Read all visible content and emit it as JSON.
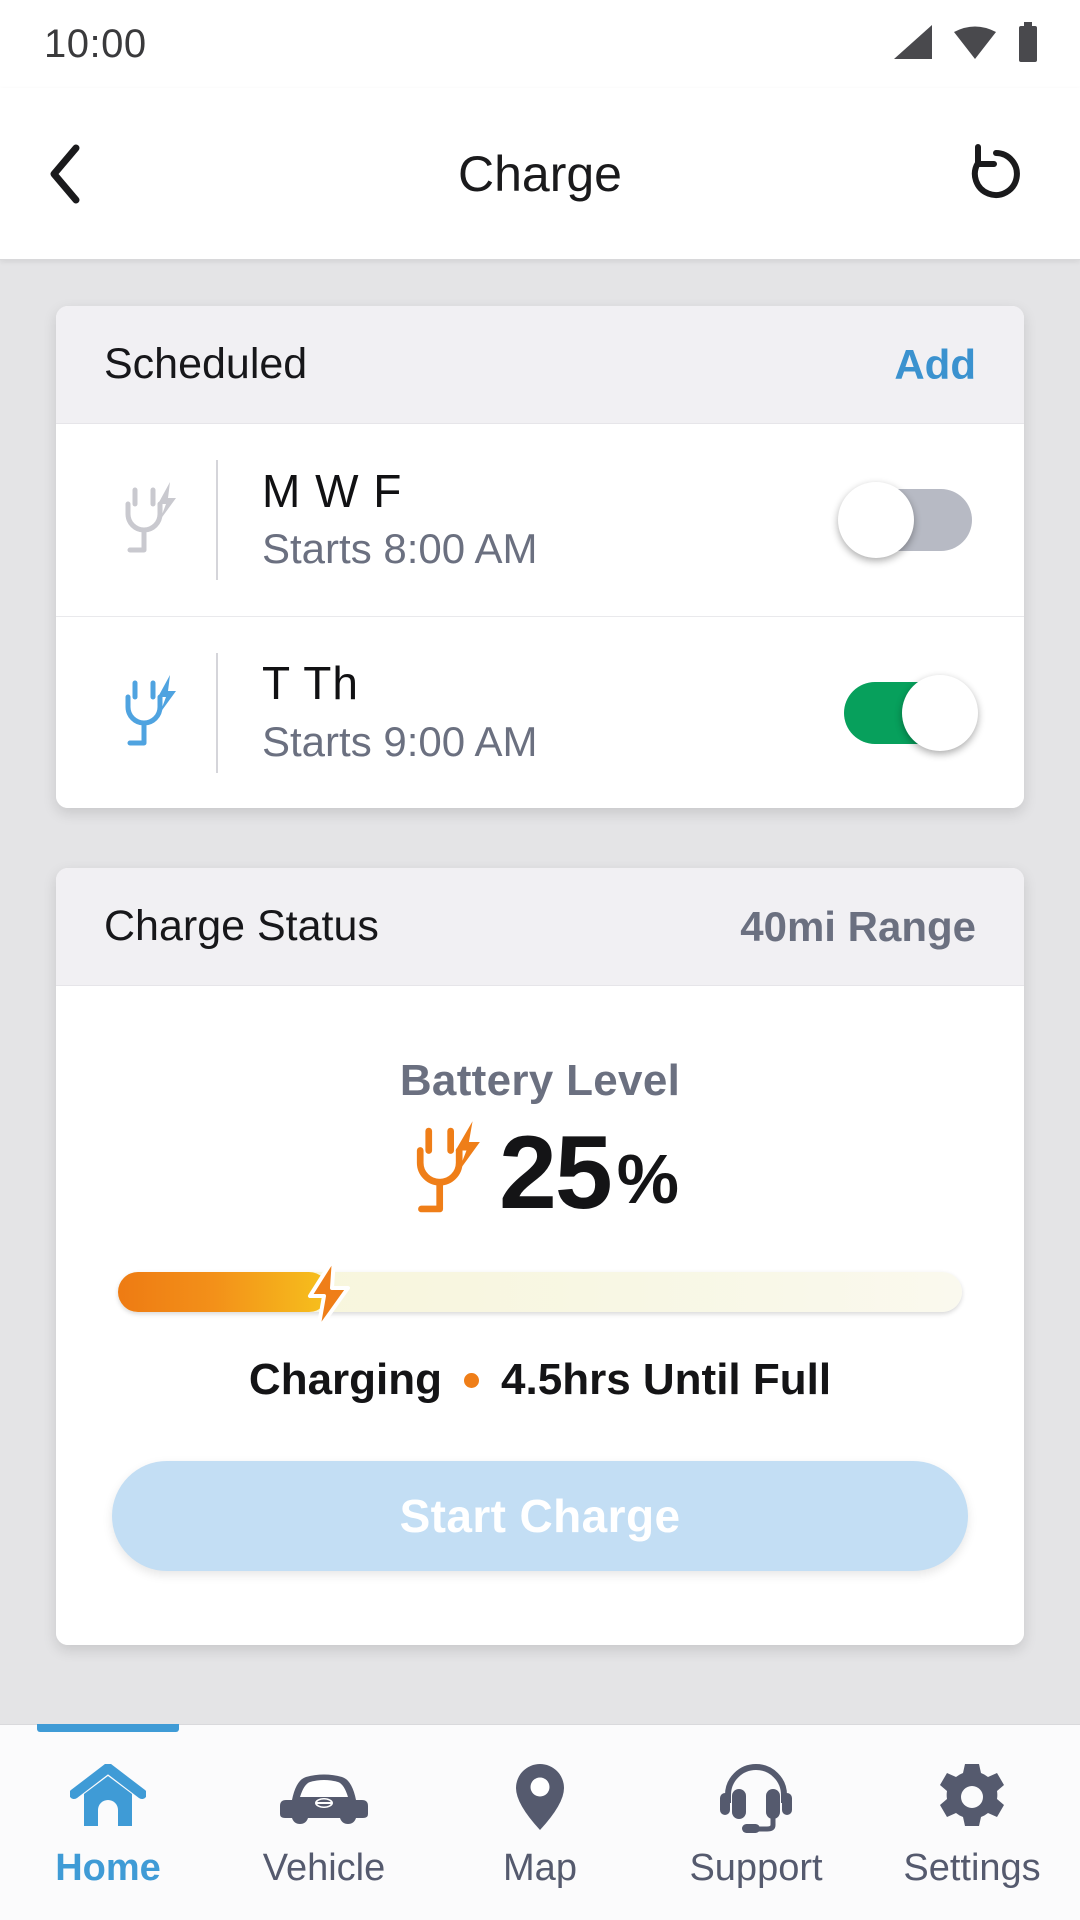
{
  "status_bar": {
    "time": "10:00",
    "icons": [
      "signal-icon",
      "wifi-icon",
      "battery-icon"
    ]
  },
  "app_bar": {
    "title": "Charge",
    "back_icon": "chevron-left-icon",
    "refresh_icon": "history-refresh-icon"
  },
  "scheduled_card": {
    "title": "Scheduled",
    "action_label": "Add",
    "rows": [
      {
        "icon": "plug-bolt-icon",
        "icon_color": "#c9c9cf",
        "days": "M W F",
        "time": "Starts 8:00 AM",
        "enabled": false
      },
      {
        "icon": "plug-bolt-icon",
        "icon_color": "#4fa3e0",
        "days": "T Th",
        "time": "Starts 9:00 AM",
        "enabled": true
      }
    ]
  },
  "charge_status_card": {
    "title": "Charge Status",
    "range_label": "40mi Range",
    "battery_label": "Battery Level",
    "battery_icon": "plug-bolt-icon",
    "battery_icon_color": "#ef7e18",
    "battery_percent_value": "25",
    "battery_percent_sign": "%",
    "battery_percent_fill": 25,
    "progress_bolt_icon": "lightning-bolt-icon",
    "charging_state": "Charging",
    "separator": "dot-separator",
    "time_until_full": "4.5hrs Until Full",
    "start_button_label": "Start Charge",
    "start_button_enabled": false
  },
  "bottom_nav": {
    "items": [
      {
        "label": "Home",
        "icon": "home-icon",
        "active": true
      },
      {
        "label": "Vehicle",
        "icon": "car-icon",
        "active": false
      },
      {
        "label": "Map",
        "icon": "map-pin-icon",
        "active": false
      },
      {
        "label": "Support",
        "icon": "headset-icon",
        "active": false
      },
      {
        "label": "Settings",
        "icon": "gear-icon",
        "active": false
      }
    ]
  },
  "colors": {
    "accent_blue": "#3f9bd6",
    "link_blue": "#3b92cf",
    "toggle_on_green": "#07a05c",
    "toggle_off_gray": "#b7bac4",
    "orange": "#ef7e18",
    "page_bg": "#e4e4e6",
    "card_header_bg": "#f1f0f3",
    "muted_text": "#6b7080"
  }
}
